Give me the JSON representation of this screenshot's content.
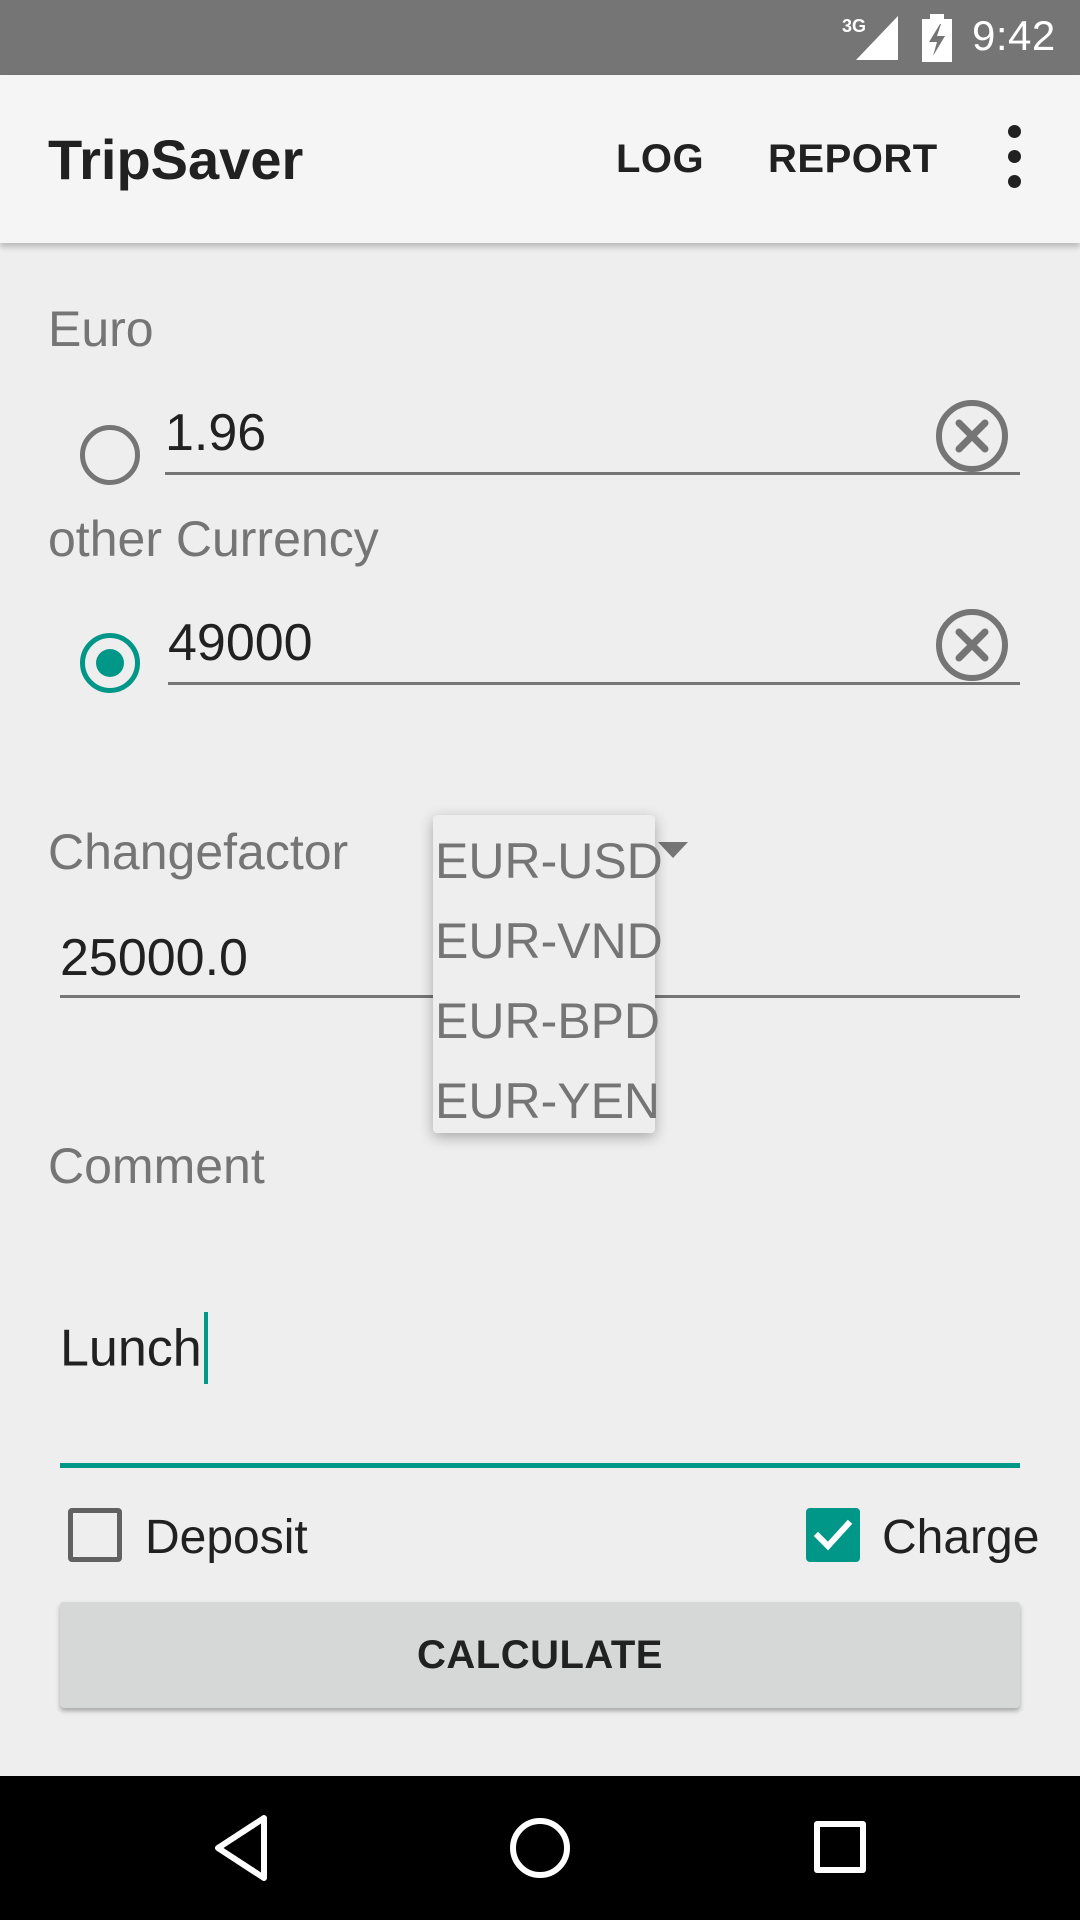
{
  "status_bar": {
    "network": "3G",
    "time": "9:42"
  },
  "app_bar": {
    "title": "TripSaver",
    "actions": [
      {
        "label": "LOG"
      },
      {
        "label": "REPORT"
      }
    ],
    "overflow_icon": "more-vert-icon"
  },
  "euro": {
    "label": "Euro",
    "value": "1.96",
    "radio_selected": false
  },
  "other_currency": {
    "label": "other Currency",
    "value": "49000",
    "radio_selected": true
  },
  "changefactor": {
    "label": "Changefactor",
    "value": "25000.0",
    "dropdown": {
      "selected": "EUR-USD",
      "options": [
        "EUR-USD",
        "EUR-VND",
        "EUR-BPD",
        "EUR-YEN"
      ]
    }
  },
  "comment": {
    "label": "Comment",
    "value": "Lunch"
  },
  "deposit": {
    "label": "Deposit",
    "checked": false
  },
  "charge": {
    "label": "Charge",
    "checked": true
  },
  "calculate": {
    "label": "CALCULATE"
  },
  "colors": {
    "accent": "#009688",
    "status_bar": "#757575",
    "app_bar": "#f5f5f5",
    "background": "#eeeeee"
  }
}
